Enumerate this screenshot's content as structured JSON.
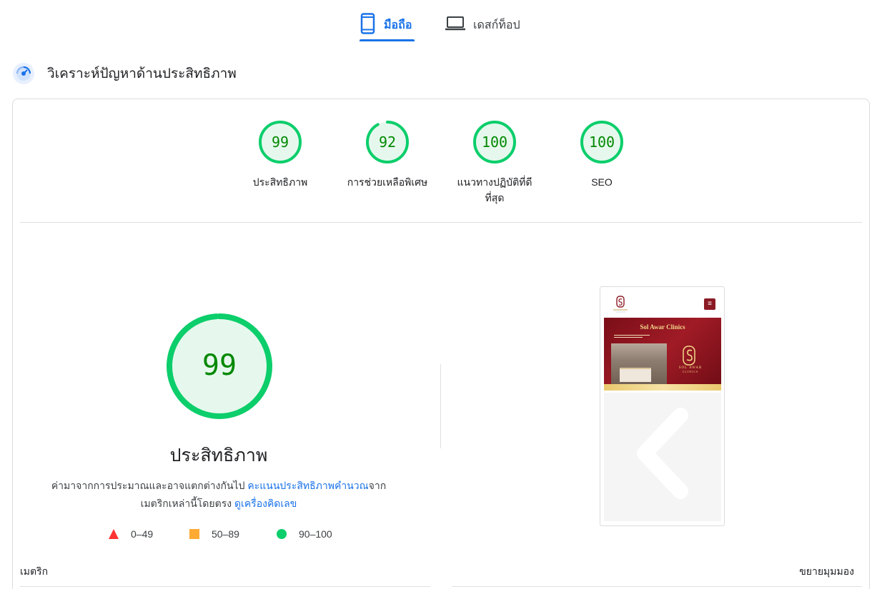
{
  "tabs": {
    "mobile_label": "มือถือ",
    "desktop_label": "เดสก์ท็อป",
    "active": "mobile"
  },
  "section": {
    "title": "วิเคราะห์ปัญหาด้านประสิทธิภาพ"
  },
  "categories": [
    {
      "score": 99,
      "label": "ประสิทธิภาพ",
      "fraction": 0.99
    },
    {
      "score": 92,
      "label": "การช่วยเหลือพิเศษ",
      "fraction": 0.92
    },
    {
      "score": 100,
      "label": "แนวทางปฏิบัติที่ดีที่สุด",
      "fraction": 1.0
    },
    {
      "score": 100,
      "label": "SEO",
      "fraction": 1.0
    }
  ],
  "main": {
    "score": 99,
    "fraction": 0.99,
    "title": "ประสิทธิภาพ",
    "desc_part1": "ค่ามาจากการประมาณและอาจแตกต่างกันไป ",
    "desc_link1": "คะแนนประสิทธิภาพคำนวณ",
    "desc_part2": "จากเมตริกเหล่านี้โดยตรง ",
    "desc_link2": "ดูเครื่องคิดเลข"
  },
  "legend": [
    {
      "range": "0–49",
      "shape": "triangle",
      "color": "#ff3333"
    },
    {
      "range": "50–89",
      "shape": "square",
      "color": "#ffaa33"
    },
    {
      "range": "90–100",
      "shape": "circle",
      "color": "#0cce6b"
    }
  ],
  "metrics": {
    "label": "เมตริก",
    "expand_label": "ขยายมุมมอง"
  },
  "screenshot": {
    "banner_title": "Sol Awar Clinics",
    "brand": "SOL AWAR",
    "brand_sub": "CLINICS"
  },
  "colors": {
    "accent": "#1a73e8",
    "pass": "#0cce6b",
    "pass_text": "#008800",
    "pass_fill": "#e6f8ed"
  }
}
